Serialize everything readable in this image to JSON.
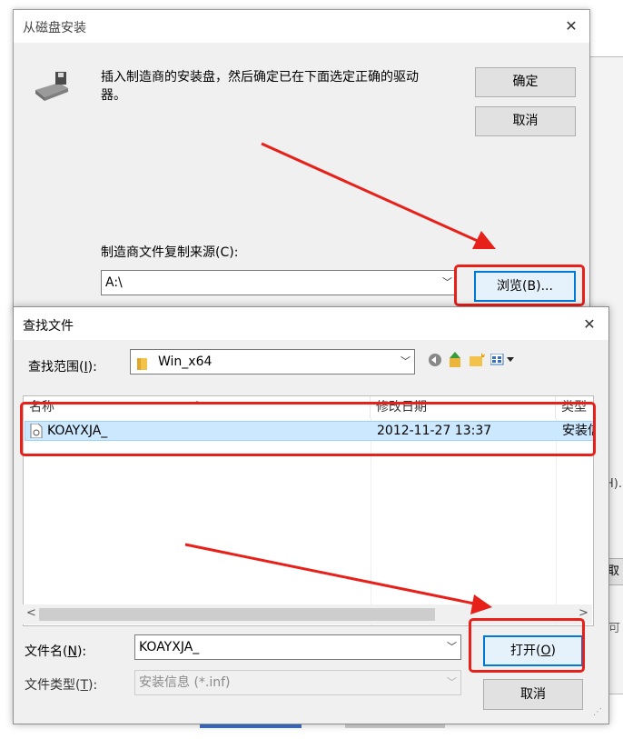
{
  "disk_dialog": {
    "title": "从磁盘安装",
    "close_glyph": "✕",
    "message_line1": "插入制造商的安装盘，然后确定已在下面选定正确的驱动",
    "message_line2": "器。",
    "ok_label": "确定",
    "cancel_label": "取消",
    "source_label": "制造商文件复制来源(C):",
    "source_value": "A:\\",
    "browse_label": "浏览(B)..."
  },
  "find_dialog": {
    "title": "查找文件",
    "close_glyph": "✕",
    "lookin_label_pre": "查找范围(",
    "lookin_label_key": "I",
    "lookin_label_post": "):",
    "lookin_value": "Win_x64",
    "columns": {
      "name": "名称",
      "modified": "修改日期",
      "type": "类型"
    },
    "files": [
      {
        "name": "KOAYXJA_",
        "modified": "2012-11-27 13:37",
        "type": "安装信"
      }
    ],
    "filename_label_pre": "文件名(",
    "filename_label_key": "N",
    "filename_label_post": "):",
    "filename_value": "KOAYXJA_",
    "filetype_label_pre": "文件类型(",
    "filetype_label_key": "T",
    "filetype_label_post": "):",
    "filetype_value": "安装信息 (*.inf)",
    "open_label_pre": "打开(",
    "open_label_key": "O",
    "open_label_post": ")",
    "cancel_label": "取消"
  },
  "background": {
    "fragment_h": "H).",
    "fragment_zoom": "可",
    "fragment_r": "取"
  },
  "colors": {
    "annotation_red": "#e8201a",
    "accent_blue": "#0078d7",
    "selection": "#cce8ff"
  }
}
